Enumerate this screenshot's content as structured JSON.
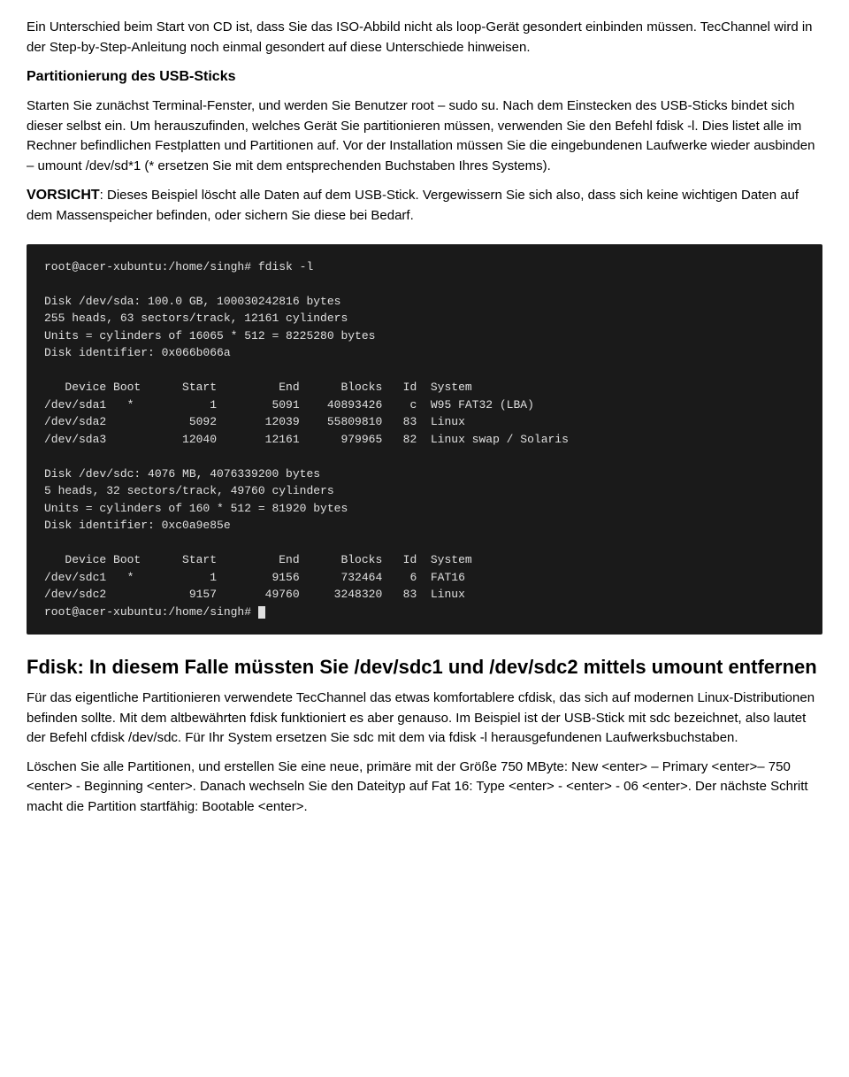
{
  "intro": {
    "para1": "Ein Unterschied beim Start von CD ist, dass Sie das ISO-Abbild nicht als loop-Gerät gesondert einbinden müssen. TecChannel wird in der Step-by-Step-Anleitung noch einmal gesondert auf diese Unterschiede hinweisen.",
    "heading": "Partitionierung des USB-Sticks",
    "para2": "Starten Sie zunächst Terminal-Fenster, und werden Sie Benutzer root – sudo su. Nach dem Einstecken des USB-Sticks bindet sich dieser selbst ein. Um herauszufinden, welches Gerät Sie partitionieren müssen, verwenden Sie den Befehl fdisk -l. Dies listet alle im Rechner befindlichen Festplatten und Partitionen auf. Vor der Installation müssen Sie die eingebundenen Laufwerke wieder ausbinden – umount /dev/sd*1 (* ersetzen Sie mit dem entsprechenden Buchstaben Ihres Systems).",
    "vorsicht_label": "VORSICHT",
    "vorsicht_text": ": Dieses Beispiel löscht alle Daten auf dem USB-Stick. Vergewissern Sie sich also, dass sich keine wichtigen Daten auf dem Massenspeicher befinden, oder sichern Sie diese bei Bedarf."
  },
  "terminal": {
    "content": "root@acer-xubuntu:/home/singh# fdisk -l\n\nDisk /dev/sda: 100.0 GB, 100030242816 bytes\n255 heads, 63 sectors/track, 12161 cylinders\nUnits = cylinders of 16065 * 512 = 8225280 bytes\nDisk identifier: 0x066b066a\n\n   Device Boot      Start         End      Blocks   Id  System\n/dev/sda1   *           1        5091    40893426    c  W95 FAT32 (LBA)\n/dev/sda2            5092       12039    55809810   83  Linux\n/dev/sda3           12040       12161      979965   82  Linux swap / Solaris\n\nDisk /dev/sdc: 4076 MB, 4076339200 bytes\n5 heads, 32 sectors/track, 49760 cylinders\nUnits = cylinders of 160 * 512 = 81920 bytes\nDisk identifier: 0xc0a9e85e\n\n   Device Boot      Start         End      Blocks   Id  System\n/dev/sdc1   *           1        9156      732464    6  FAT16\n/dev/sdc2            9157       49760     3248320   83  Linux\nroot@acer-xubuntu:/home/singh# "
  },
  "fdisk_note": {
    "text": "Fdisk: In diesem Falle müssten Sie /dev/sdc1 und /dev/sdc2 mittels umount entfernen"
  },
  "closing": {
    "para1": "Für das eigentliche Partitionieren verwendete TecChannel das etwas komfortablere cfdisk, das sich auf modernen Linux-Distributionen befinden sollte. Mit dem altbewährten fdisk funktioniert es aber genauso. Im Beispiel ist der USB-Stick mit sdc bezeichnet, also lautet der Befehl cfdisk /dev/sdc. Für Ihr System ersetzen Sie sdc mit dem via fdisk -l herausgefundenen Laufwerksbuchstaben.",
    "para2": "Löschen Sie alle Partitionen, und erstellen Sie eine neue, primäre mit der Größe 750 MByte: New <enter> – Primary <enter>– 750 <enter> - Beginning <enter>. Danach wechseln Sie den Dateityp auf Fat 16: Type <enter> - <enter> - 06 <enter>. Der nächste Schritt macht die Partition startfähig: Bootable <enter>."
  }
}
